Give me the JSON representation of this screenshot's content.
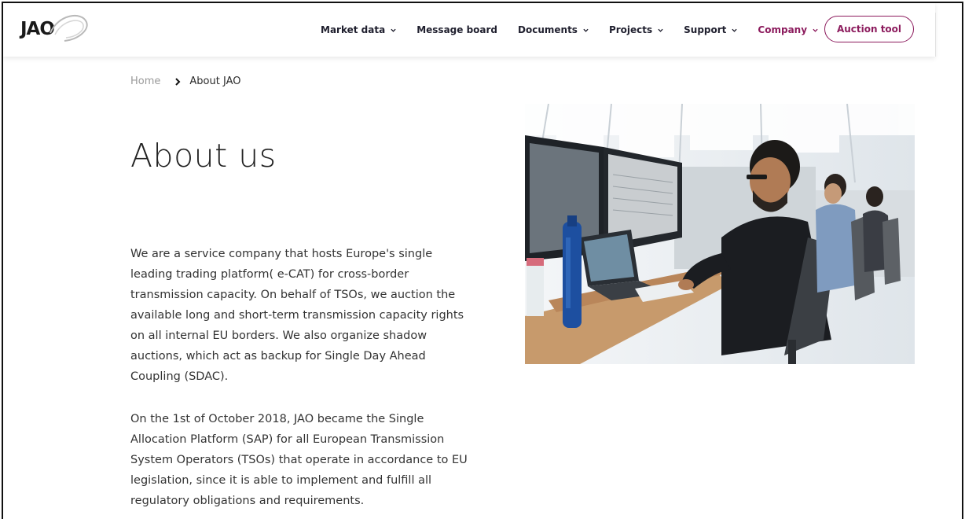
{
  "header": {
    "logo_text": "JAO",
    "nav": [
      {
        "label": "Market data",
        "has_dropdown": true
      },
      {
        "label": "Message board",
        "has_dropdown": false
      },
      {
        "label": "Documents",
        "has_dropdown": true
      },
      {
        "label": "Projects",
        "has_dropdown": true
      },
      {
        "label": "Support",
        "has_dropdown": true
      },
      {
        "label": "Company",
        "has_dropdown": true,
        "active": true
      }
    ],
    "cta_label": "Auction tool"
  },
  "breadcrumb": {
    "home": "Home",
    "separator_icon": "chevron-right-icon",
    "current": "About JAO"
  },
  "page": {
    "title": "About us",
    "paragraphs": [
      "We are a service company that hosts Europe's single leading trading platform( e-CAT) for cross-border transmission capacity. On behalf of TSOs, we auction the available long and short-term transmission capacity rights on all internal EU borders. We also organize shadow auctions, which act as backup for Single Day Ahead Coupling (SDAC).",
      "On the 1st of October 2018, JAO became the Single Allocation Platform (SAP) for all European Transmission System Operators (TSOs) that operate in accordance to EU legislation, since it is able to implement and fulfill all regulatory obligations and requirements."
    ]
  },
  "colors": {
    "brand": "#8c1b5d",
    "text": "#2b2b2b",
    "muted": "#9a9a9a"
  },
  "image": {
    "subject": "office-photo"
  }
}
